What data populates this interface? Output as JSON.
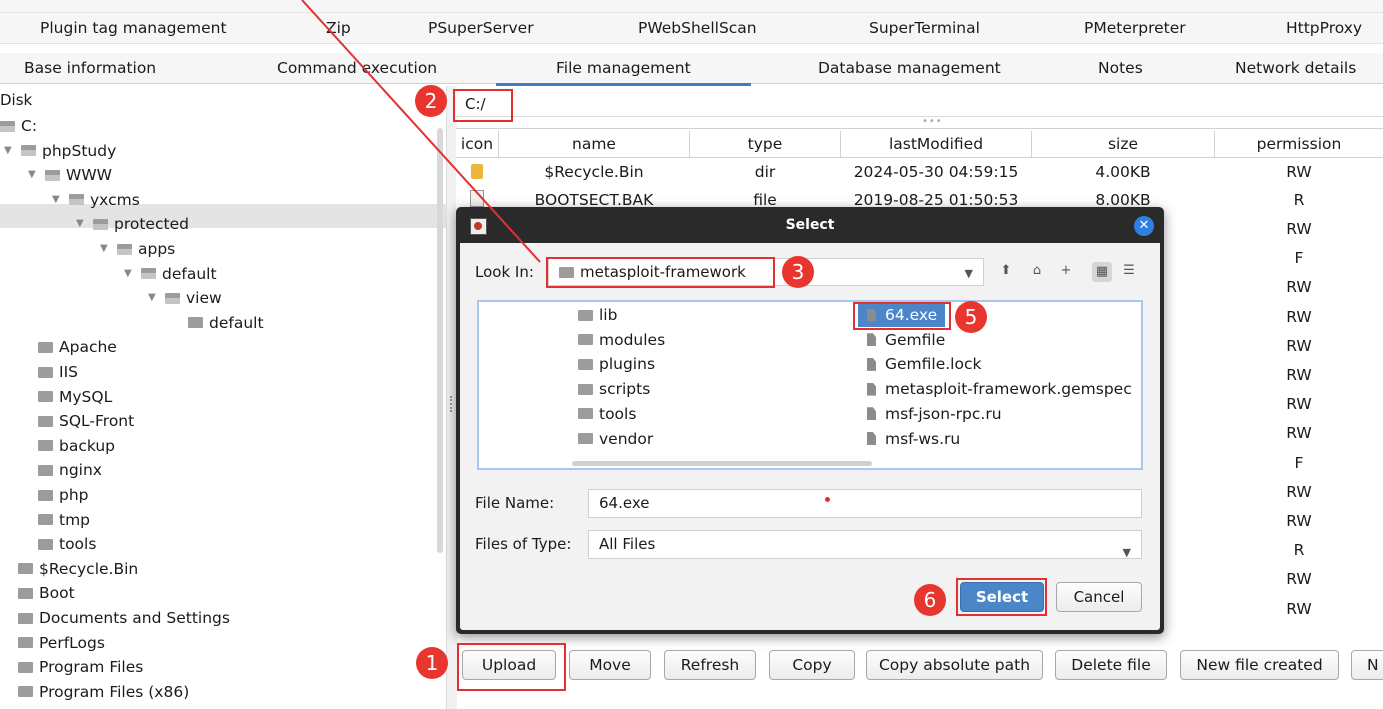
{
  "tabs_row1": [
    "Plugin tag management",
    "Zip",
    "PSuperServer",
    "PWebShellScan",
    "SuperTerminal",
    "PMeterpreter",
    "HttpProxy"
  ],
  "tabs_row2": [
    "Base information",
    "Command execution",
    "File management",
    "Database management",
    "Notes",
    "Network details"
  ],
  "active_tab": "File management",
  "tree": {
    "header": "Disk",
    "nodes": [
      {
        "label": "C:",
        "level": 0,
        "expanded": true,
        "selected": true
      },
      {
        "label": "phpStudy",
        "level": 1,
        "expanded": true
      },
      {
        "label": "WWW",
        "level": 2,
        "expanded": true
      },
      {
        "label": "yxcms",
        "level": 3,
        "expanded": true
      },
      {
        "label": "protected",
        "level": 4,
        "expanded": true
      },
      {
        "label": "apps",
        "level": 5,
        "expanded": true
      },
      {
        "label": "default",
        "level": 6,
        "expanded": true
      },
      {
        "label": "view",
        "level": 7,
        "expanded": true
      },
      {
        "label": "default",
        "level": 8,
        "expanded": false
      },
      {
        "label": "Apache",
        "level": 2
      },
      {
        "label": "IIS",
        "level": 2
      },
      {
        "label": "MySQL",
        "level": 2
      },
      {
        "label": "SQL-Front",
        "level": 2
      },
      {
        "label": "backup",
        "level": 2
      },
      {
        "label": "nginx",
        "level": 2
      },
      {
        "label": "php",
        "level": 2
      },
      {
        "label": "tmp",
        "level": 2
      },
      {
        "label": "tools",
        "level": 2
      },
      {
        "label": "$Recycle.Bin",
        "level": 1
      },
      {
        "label": "Boot",
        "level": 1
      },
      {
        "label": "Documents and Settings",
        "level": 1
      },
      {
        "label": "PerfLogs",
        "level": 1
      },
      {
        "label": "Program Files",
        "level": 1
      },
      {
        "label": "Program Files (x86)",
        "level": 1
      }
    ]
  },
  "path_value": "C:/",
  "table": {
    "headers": [
      "icon",
      "name",
      "type",
      "lastModified",
      "size",
      "permission"
    ],
    "rows": [
      {
        "icon": "folder-icon",
        "name": "$Recycle.Bin",
        "type": "dir",
        "lastModified": "2024-05-30 04:59:15",
        "size": "4.00KB",
        "permission": "RW"
      },
      {
        "icon": "file-icon",
        "name": "BOOTSECT.BAK",
        "type": "file",
        "lastModified": "2019-08-25 01:50:53",
        "size": "8.00KB",
        "permission": "R"
      }
    ],
    "permissions_visible": [
      "RW",
      "F",
      "RW",
      "RW",
      "RW",
      "RW",
      "RW",
      "RW",
      "F",
      "RW",
      "RW",
      "R",
      "RW",
      "RW"
    ]
  },
  "buttons": [
    "Upload",
    "Move",
    "Refresh",
    "Copy",
    "Copy absolute path",
    "Delete file",
    "New file created",
    "N"
  ],
  "dialog": {
    "title": "Select",
    "look_in_label": "Look In:",
    "look_in_value": "metasploit-framework",
    "folders": [
      "lib",
      "modules",
      "plugins",
      "scripts",
      "tools",
      "vendor"
    ],
    "files": [
      "64.exe",
      "Gemfile",
      "Gemfile.lock",
      "metasploit-framework.gemspec",
      "msf-json-rpc.ru",
      "msf-ws.ru"
    ],
    "selected_file": "64.exe",
    "file_name_label": "File Name:",
    "file_name_value": "64.exe",
    "files_of_type_label": "Files of Type:",
    "files_of_type_value": "All Files",
    "select_label": "Select",
    "cancel_label": "Cancel"
  },
  "annotations": [
    "1",
    "2",
    "3",
    "5",
    "6"
  ],
  "colors": {
    "accent": "#3d7dc4",
    "annotation": "#e8352d",
    "dialog_title_bar": "#2a2a2a",
    "select_button": "#4a86c8"
  }
}
